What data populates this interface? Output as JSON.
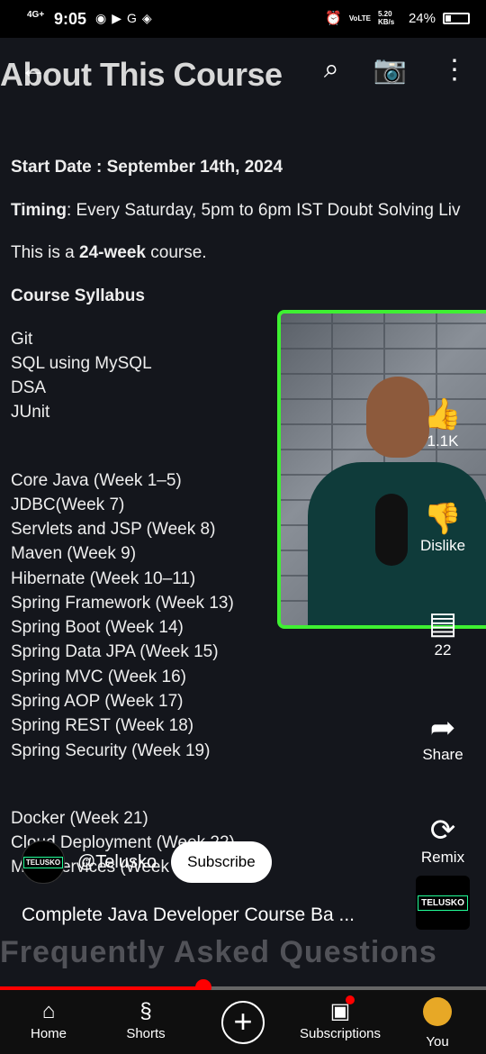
{
  "status_bar": {
    "network": "4G+",
    "time": "9:05",
    "icons": [
      "screen-record-icon",
      "youtube-icon",
      "google-icon",
      "app-icon"
    ],
    "right_icons": [
      "alarm-icon",
      "volte-icon"
    ],
    "volte": "VoLTE",
    "speed": "5.20 KB/s",
    "battery": "24%"
  },
  "video": {
    "title_overlay": "About This Course",
    "lines": {
      "start_label": "Start Date : September 14th, 2024",
      "timing_label": "Timing",
      "timing_text": ":  Every Saturday, 5pm to 6pm IST Doubt Solving Liv",
      "course_pre": "This is a ",
      "course_bold": "24-week",
      "course_post": " course.",
      "syllabus": "Course Syllabus",
      "items1": [
        "Git",
        "SQL using MySQL",
        "DSA",
        "JUnit"
      ],
      "items2": [
        "Core Java (Week 1–5)",
        "JDBC(Week 7)",
        "Servlets and JSP (Week 8)",
        "Maven (Week 9)",
        "Hibernate (Week 10–11)",
        "Spring Framework (Week 13)",
        "Spring Boot (Week 14)",
        "Spring Data JPA (Week 15)",
        "Spring MVC (Week 16)",
        "Spring AOP (Week 17)",
        "Spring REST (Week 18)",
        "Spring Security (Week 19)"
      ],
      "items3": [
        "Docker (Week 21)",
        "Cloud Deployment (Week 22)",
        "Microservices (Week 23–24)"
      ],
      "faded": "Frequently Asked Questions"
    }
  },
  "actions": {
    "like_count": "1.1K",
    "dislike": "Dislike",
    "comments": "22",
    "share": "Share",
    "remix": "Remix"
  },
  "channel": {
    "logo_text": "TELUSKO",
    "handle": "@Telusko",
    "subscribe": "Subscribe"
  },
  "short_title": "Complete Java Developer Course Ba ...",
  "progress": 0.42,
  "nav": {
    "home": "Home",
    "shorts": "Shorts",
    "subscriptions": "Subscriptions",
    "you": "You"
  }
}
